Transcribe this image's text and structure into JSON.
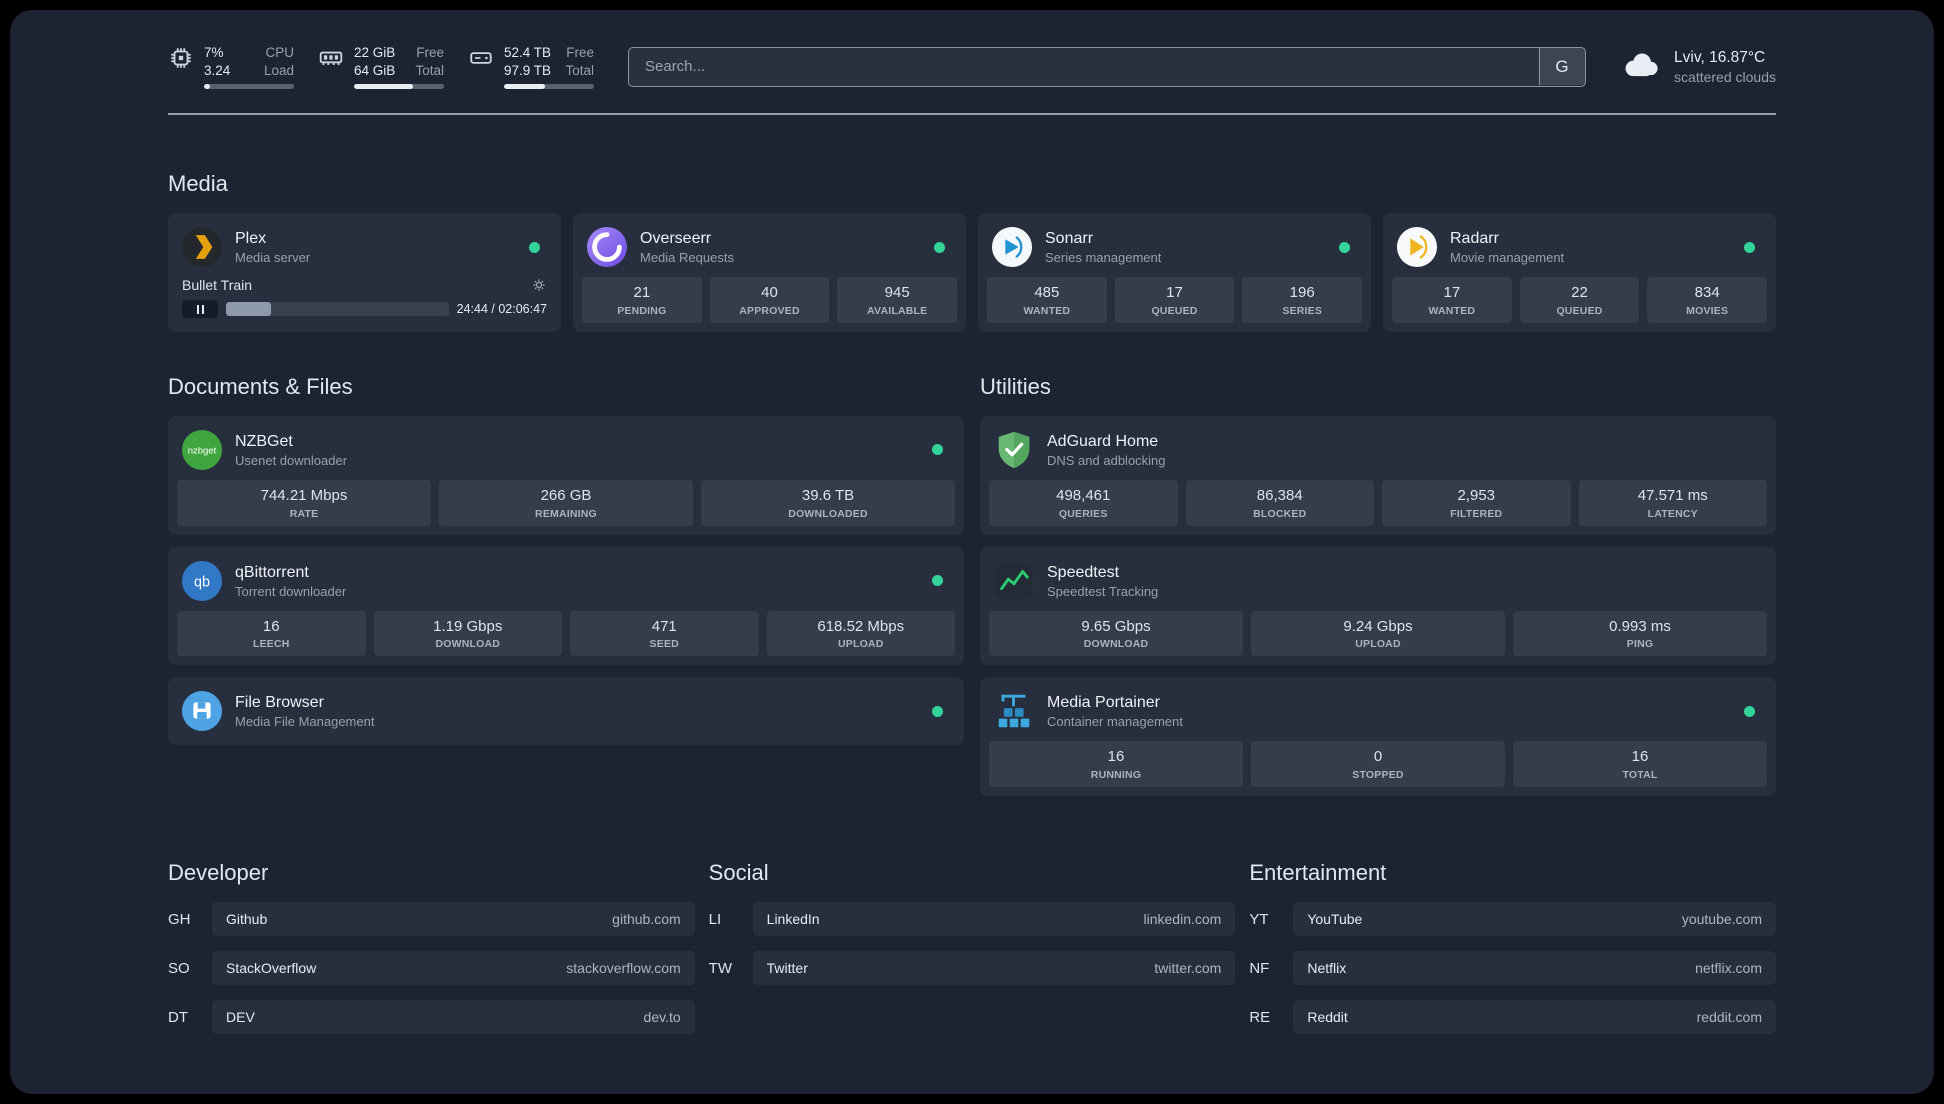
{
  "colors": {
    "background": "#1c2434",
    "card": "rgba(255,255,255,0.05)",
    "status_online": "#34d399",
    "accent_green": "#2ecc71"
  },
  "icons": {
    "cpu-icon": "chip",
    "memory-icon": "ram-stick",
    "disk-icon": "hard-drive",
    "cloud-icon": "cloud",
    "plex-icon": "amber-chevron-dark-circle",
    "overseerr-icon": "purple-swirl-circle",
    "sonarr-icon": "blue-play-white-circle",
    "radarr-icon": "amber-play-white-circle",
    "nzbget-icon": "green-circle-nzbget-text",
    "qbittorrent-icon": "blue-circle-qb-text",
    "filebrowser-icon": "blue-circle-white-floppy",
    "adguard-icon": "green-shield-check",
    "speedtest-icon": "green-line-chart-dark-square",
    "portainer-icon": "blue-crane-containers",
    "gear-icon": "gear",
    "pause-icon": "pause-bars",
    "status-dot": "green-circle"
  },
  "topbar": {
    "resources": [
      {
        "icon": "cpu-icon",
        "percent": 7,
        "rows": [
          {
            "value": "7%",
            "label": "CPU"
          },
          {
            "value": "3.24",
            "label": "Load"
          }
        ]
      },
      {
        "icon": "memory-icon",
        "percent": 66,
        "rows": [
          {
            "value": "22 GiB",
            "label": "Free"
          },
          {
            "value": "64 GiB",
            "label": "Total"
          }
        ]
      },
      {
        "icon": "disk-icon",
        "percent": 46,
        "rows": [
          {
            "value": "52.4 TB",
            "label": "Free"
          },
          {
            "value": "97.9 TB",
            "label": "Total"
          }
        ]
      }
    ],
    "search": {
      "placeholder": "Search...",
      "provider_label": "G"
    },
    "weather": {
      "icon": "cloud-icon",
      "location": "Lviv, 16.87°C",
      "condition": "scattered clouds"
    }
  },
  "sections": {
    "media": {
      "title": "Media",
      "services": [
        {
          "name": "Plex",
          "subtitle": "Media server",
          "online": true,
          "player": {
            "title": "Bullet Train",
            "time": "24:44 / 02:06:47",
            "progress_percent": 20
          }
        },
        {
          "name": "Overseerr",
          "subtitle": "Media Requests",
          "online": true,
          "stats": [
            {
              "value": "21",
              "label": "PENDING"
            },
            {
              "value": "40",
              "label": "APPROVED"
            },
            {
              "value": "945",
              "label": "AVAILABLE"
            }
          ]
        },
        {
          "name": "Sonarr",
          "subtitle": "Series management",
          "online": true,
          "stats": [
            {
              "value": "485",
              "label": "WANTED"
            },
            {
              "value": "17",
              "label": "QUEUED"
            },
            {
              "value": "196",
              "label": "SERIES"
            }
          ]
        },
        {
          "name": "Radarr",
          "subtitle": "Movie management",
          "online": true,
          "stats": [
            {
              "value": "17",
              "label": "WANTED"
            },
            {
              "value": "22",
              "label": "QUEUED"
            },
            {
              "value": "834",
              "label": "MOVIES"
            }
          ]
        }
      ]
    },
    "documents": {
      "title": "Documents & Files",
      "services": [
        {
          "name": "NZBGet",
          "subtitle": "Usenet downloader",
          "online": true,
          "icon_text": "nzbget",
          "stats": [
            {
              "value": "744.21 Mbps",
              "label": "RATE"
            },
            {
              "value": "266 GB",
              "label": "REMAINING"
            },
            {
              "value": "39.6 TB",
              "label": "DOWNLOADED"
            }
          ]
        },
        {
          "name": "qBittorrent",
          "subtitle": "Torrent downloader",
          "online": true,
          "icon_text": "qb",
          "stats": [
            {
              "value": "16",
              "label": "LEECH"
            },
            {
              "value": "1.19 Gbps",
              "label": "DOWNLOAD"
            },
            {
              "value": "471",
              "label": "SEED"
            },
            {
              "value": "618.52 Mbps",
              "label": "UPLOAD"
            }
          ]
        },
        {
          "name": "File Browser",
          "subtitle": "Media File Management",
          "online": true
        }
      ]
    },
    "utilities": {
      "title": "Utilities",
      "services": [
        {
          "name": "AdGuard Home",
          "subtitle": "DNS and adblocking",
          "stats": [
            {
              "value": "498,461",
              "label": "QUERIES"
            },
            {
              "value": "86,384",
              "label": "BLOCKED"
            },
            {
              "value": "2,953",
              "label": "FILTERED"
            },
            {
              "value": "47.571 ms",
              "label": "LATENCY"
            }
          ]
        },
        {
          "name": "Speedtest",
          "subtitle": "Speedtest Tracking",
          "stats": [
            {
              "value": "9.65 Gbps",
              "label": "DOWNLOAD"
            },
            {
              "value": "9.24 Gbps",
              "label": "UPLOAD"
            },
            {
              "value": "0.993 ms",
              "label": "PING"
            }
          ]
        },
        {
          "name": "Media Portainer",
          "subtitle": "Container management",
          "online": true,
          "stats": [
            {
              "value": "16",
              "label": "RUNNING"
            },
            {
              "value": "0",
              "label": "STOPPED"
            },
            {
              "value": "16",
              "label": "TOTAL"
            }
          ]
        }
      ]
    }
  },
  "bookmarks": [
    {
      "title": "Developer",
      "items": [
        {
          "abbr": "GH",
          "name": "Github",
          "url": "github.com"
        },
        {
          "abbr": "SO",
          "name": "StackOverflow",
          "url": "stackoverflow.com"
        },
        {
          "abbr": "DT",
          "name": "DEV",
          "url": "dev.to"
        }
      ]
    },
    {
      "title": "Social",
      "items": [
        {
          "abbr": "LI",
          "name": "LinkedIn",
          "url": "linkedin.com"
        },
        {
          "abbr": "TW",
          "name": "Twitter",
          "url": "twitter.com"
        }
      ]
    },
    {
      "title": "Entertainment",
      "items": [
        {
          "abbr": "YT",
          "name": "YouTube",
          "url": "youtube.com"
        },
        {
          "abbr": "NF",
          "name": "Netflix",
          "url": "netflix.com"
        },
        {
          "abbr": "RE",
          "name": "Reddit",
          "url": "reddit.com"
        }
      ]
    }
  ]
}
